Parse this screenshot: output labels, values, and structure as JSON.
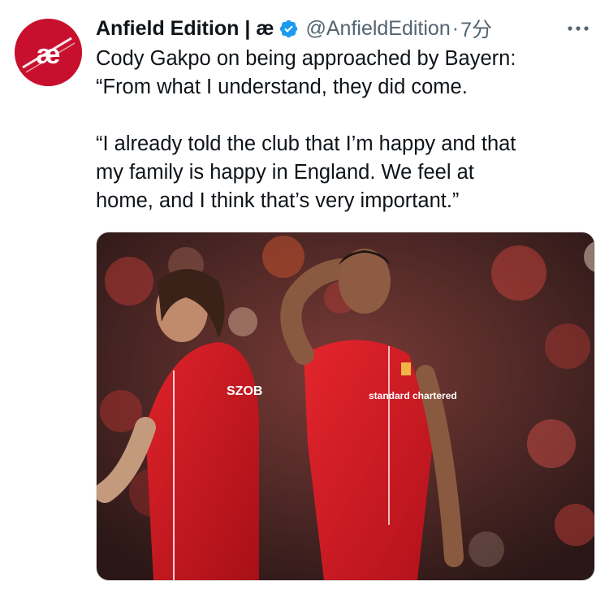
{
  "tweet": {
    "author": {
      "display_name": "Anfield Edition | æ",
      "handle": "@AnfieldEdition",
      "avatar_text": "æ",
      "verified": true
    },
    "separator": "·",
    "timestamp": "7分",
    "text_lines": [
      "Cody Gakpo on being approached by Bayern:",
      "“From what I understand, they did come.",
      "“I already told the club that I’m happy and that",
      "my family is happy in England. We feel at",
      "home, and I think that’s very important.”"
    ],
    "paragraphs": [
      "Cody Gakpo on being approached by Bayern: “From what I understand, they did come.",
      "“I already told the club that I’m happy and that my family is happy in England. We feel at home, and I think that’s very important.”"
    ],
    "media": {
      "kit_text_left": "SZOB",
      "kit_text_sponsor": "standard chartered"
    }
  },
  "colors": {
    "avatar_bg": "#c8102e",
    "verified": "#1d9bf0",
    "secondary_text": "#536471",
    "kit_red": "#d0161f"
  },
  "icons": [
    "verified-badge-icon",
    "more-options-icon"
  ]
}
